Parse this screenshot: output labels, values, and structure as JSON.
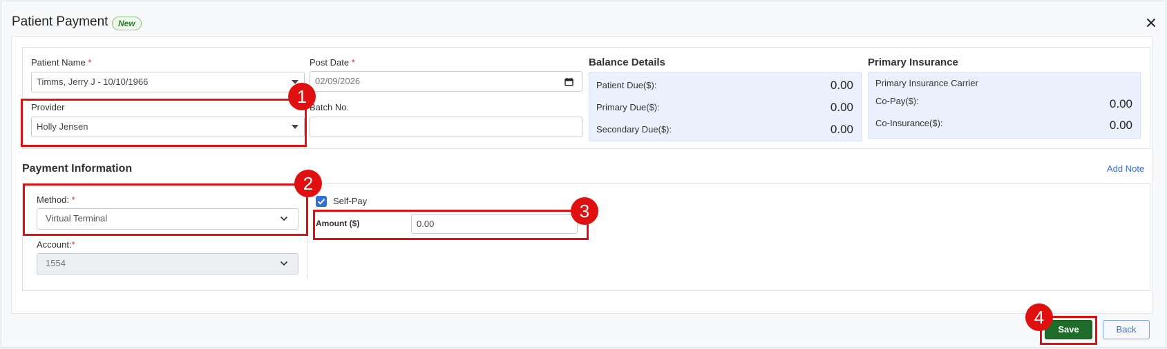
{
  "dialog": {
    "title": "Patient Payment",
    "badge": "New"
  },
  "patient": {
    "name_label": "Patient Name",
    "required_mark": "*",
    "name_value": "Timms, Jerry J - 10/10/1966",
    "post_date_label": "Post Date",
    "post_date_value": "02/09/2026",
    "provider_label": "Provider",
    "provider_value": "Holly Jensen",
    "batch_label": "Batch No.",
    "batch_value": ""
  },
  "balance": {
    "title": "Balance Details",
    "rows": [
      {
        "label": "Patient Due($):",
        "value": "0.00"
      },
      {
        "label": "Primary Due($):",
        "value": "0.00"
      },
      {
        "label": "Secondary Due($):",
        "value": "0.00"
      }
    ]
  },
  "insurance": {
    "title": "Primary Insurance",
    "carrier_label": "Primary Insurance Carrier",
    "rows": [
      {
        "label": "Co-Pay($):",
        "value": "0.00"
      },
      {
        "label": "Co-Insurance($):",
        "value": "0.00"
      }
    ]
  },
  "payment": {
    "title": "Payment Information",
    "add_note": "Add Note",
    "method_label": "Method:",
    "method_value": "Virtual Terminal",
    "account_label": "Account:",
    "account_value": "1554",
    "self_pay_label": "Self-Pay",
    "self_pay_checked": true,
    "amount_label": "Amount ($)",
    "amount_value": "0.00"
  },
  "footer": {
    "save_label": "Save",
    "back_label": "Back"
  },
  "annotations": {
    "markers": [
      "1",
      "2",
      "3",
      "4"
    ],
    "color": "#e01010"
  }
}
